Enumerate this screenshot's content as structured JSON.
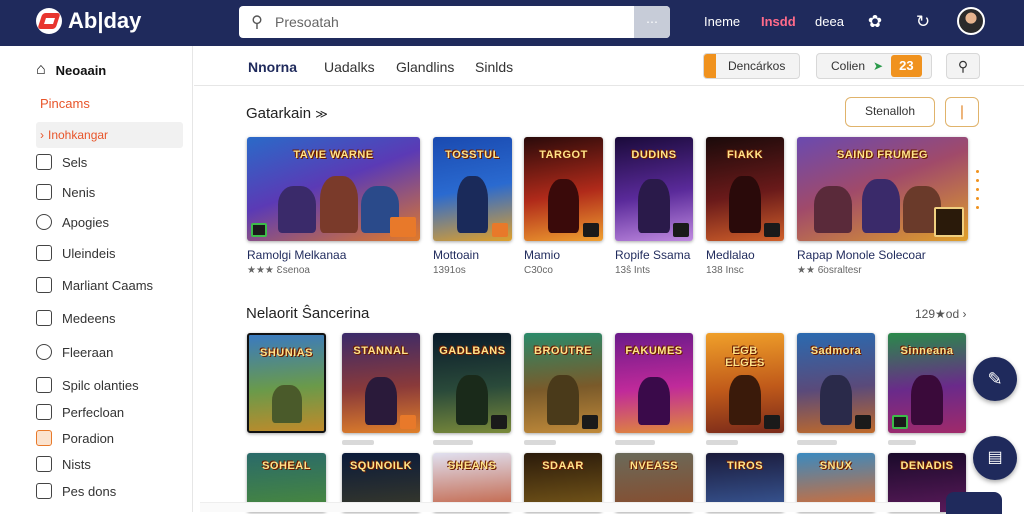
{
  "app": {
    "logo_text": "Ab|day",
    "search_placeholder": "Presoatah",
    "search_button": "⋯",
    "top_links": [
      "Ineme",
      "Insdd",
      "deea"
    ],
    "accent_navy": "#1f2a5c",
    "accent_orange": "#f0921e"
  },
  "sidebar": {
    "home_label": "Neoaain",
    "category_heading": "Pincams",
    "active_item": "Inohkangar",
    "items": [
      {
        "label": "Sels",
        "icon": "monitor-icon"
      },
      {
        "label": "Nenis",
        "icon": "window-icon"
      },
      {
        "label": "Apogies",
        "icon": "search-icon"
      },
      {
        "label": "Uleindeis",
        "icon": "grid-icon"
      },
      {
        "label": "Marliant Caams",
        "icon": "list-icon"
      },
      {
        "label": "Medeens",
        "icon": "device-icon"
      },
      {
        "label": "Fleeraan",
        "icon": "clock-icon"
      },
      {
        "label": "Spilc olanties",
        "icon": "chart-icon"
      },
      {
        "label": "Perfecloan",
        "icon": "bars-icon"
      },
      {
        "label": "Poradion",
        "icon": "card-icon"
      },
      {
        "label": "Nists",
        "icon": "box-icon"
      },
      {
        "label": "Pes dons",
        "icon": "cart-icon"
      }
    ]
  },
  "subnav": {
    "tabs": [
      "Nnorna",
      "Uadalks",
      "Glandlins",
      "Sinlds"
    ],
    "pill_left": "Dencárkos",
    "pill_right_label": "Colien",
    "pill_right_arrow": "➤",
    "pill_right_badge": "23",
    "search_icon": "search-icon"
  },
  "section1": {
    "title": "Gatarkain",
    "title_arrow": "≫",
    "sort_label": "Stenalloh",
    "filter_icon": "filter-icon",
    "cards": [
      {
        "title": "Ramolgi Melkanaa",
        "meta": "★★★ Ɛsenoa",
        "art": "TAVIE WARNE"
      },
      {
        "title": "Mottoain",
        "meta": "1391os",
        "art": "TOSSTUL"
      },
      {
        "title": "Mamio",
        "meta": "C30co",
        "art": "TARGOT"
      },
      {
        "title": "Ropife Ssama",
        "meta": "13ŝ Ints",
        "art": "DUDINS"
      },
      {
        "title": "Medlalao",
        "meta": "138 Insc",
        "art": "FIAKK"
      },
      {
        "title": "Rapap Monole Solecoar",
        "meta": "★★ 6̈osraltesr",
        "art": "SAIND FRUMEG"
      }
    ]
  },
  "section2": {
    "title": "Nelaorit Ŝancerina",
    "see_more": "129★od",
    "cards_row1": [
      "SHUNIAS",
      "STANNAL",
      "GADLBANS",
      "BROUTRE",
      "FAKUMES",
      "EGB ELGES",
      "Sadmora",
      "Sinneana"
    ],
    "cards_row2": [
      "SOHEAL",
      "SQUNOILK",
      "SHEANS",
      "SDAAR",
      "NVEASS",
      "TIROS",
      "SNUX",
      "DENADIS"
    ]
  },
  "fabs": {
    "edit_icon": "pencil-icon",
    "wallet_icon": "wallet-icon"
  }
}
